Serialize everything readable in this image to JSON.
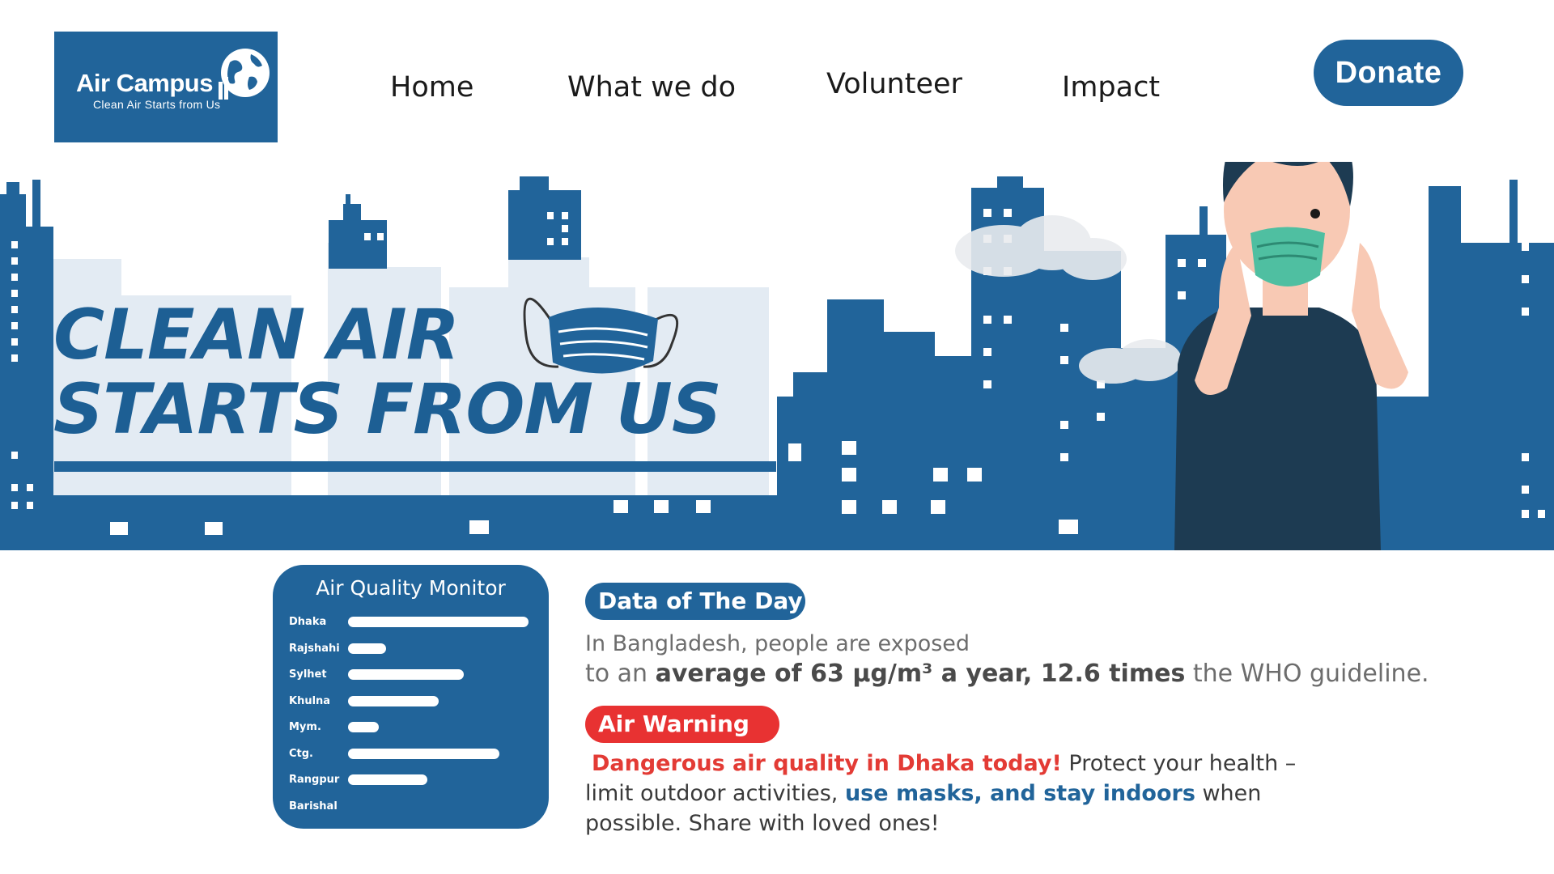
{
  "brand": {
    "name": "Air Campus",
    "tagline": "Clean Air Starts from Us",
    "color": "#21649a"
  },
  "nav": {
    "items": [
      {
        "label": "Home"
      },
      {
        "label": "What we do"
      },
      {
        "label": "Volunteer"
      },
      {
        "label": "Impact"
      }
    ],
    "donate_label": "Donate"
  },
  "hero": {
    "title_line1": "CLEAN AIR",
    "title_line2": "STARTS FROM US"
  },
  "air_quality_monitor": {
    "title": "Air Quality Monitor",
    "cities": [
      {
        "name": "Dhaka",
        "level": 1.0
      },
      {
        "name": "Rajshahi",
        "level": 0.21
      },
      {
        "name": "Sylhet",
        "level": 0.64
      },
      {
        "name": "Khulna",
        "level": 0.5
      },
      {
        "name": "Mym.",
        "level": 0.17
      },
      {
        "name": "Ctg.",
        "level": 0.84
      },
      {
        "name": "Rangpur",
        "level": 0.44
      },
      {
        "name": "Barishal",
        "level": 0
      }
    ]
  },
  "data_of_day": {
    "label": "Data of The Day",
    "line1": "In Bangladesh, people are exposed",
    "line2_prefix": "to an ",
    "line2_bold": "average of 63 μg/m³ a year, 12.6 times",
    "line2_suffix": " the WHO guideline."
  },
  "air_warning": {
    "label": "Air Warning",
    "alert": "Dangerous air quality in Dhaka today!",
    "text1": " Protect your health –",
    "text2": "limit outdoor activities, ",
    "highlight": "use masks, and stay indoors",
    "text3": " when",
    "text4": "possible. Share with loved ones!",
    "alert_color": "#e83232"
  }
}
